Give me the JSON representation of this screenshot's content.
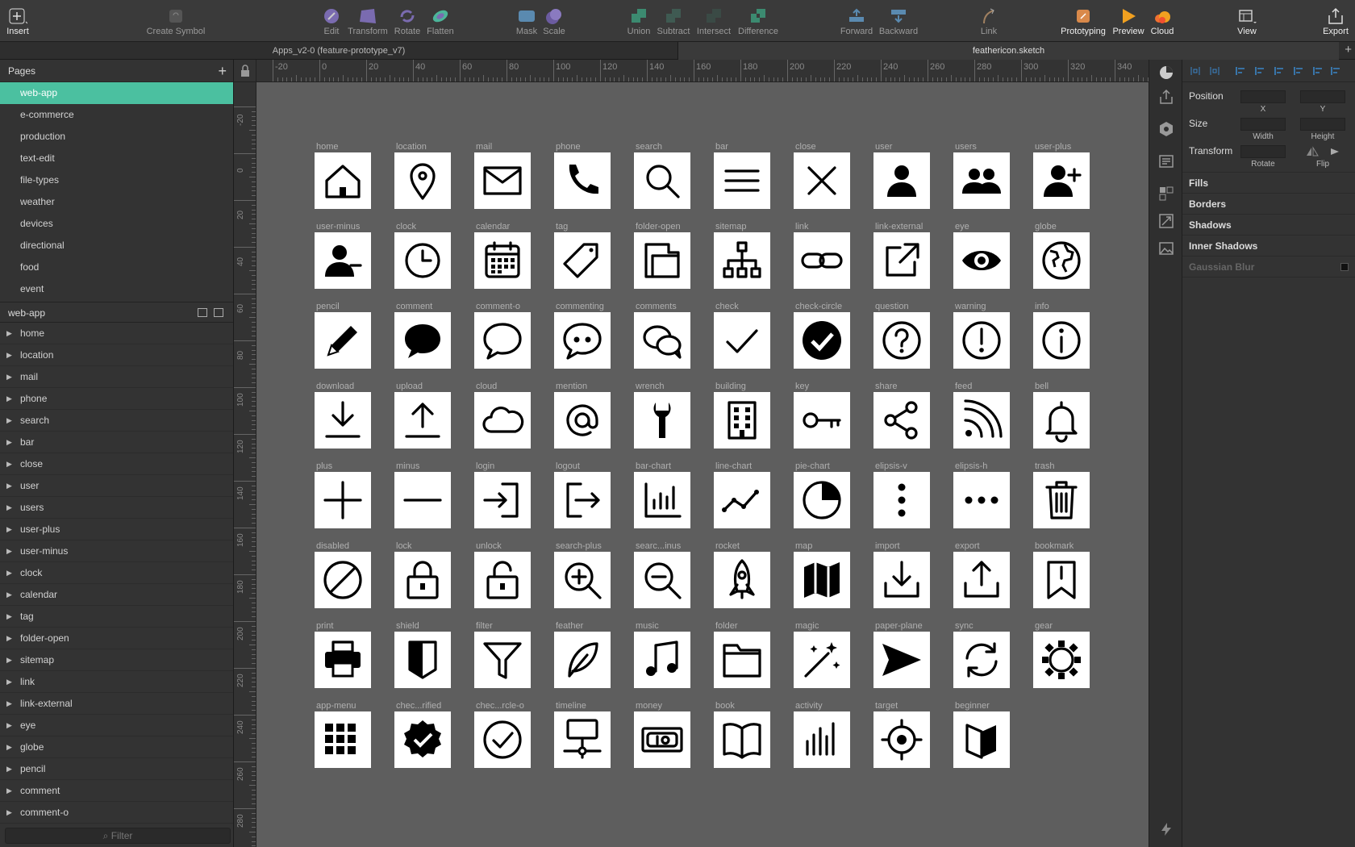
{
  "toolbar": {
    "items": [
      {
        "label": "Insert",
        "icon": "plus-icon",
        "white": true
      },
      {
        "label": "Create Symbol",
        "icon": "symbol-icon"
      },
      {
        "label": "Edit",
        "icon": "edit-icon"
      },
      {
        "label": "Transform",
        "icon": "transform-icon"
      },
      {
        "label": "Rotate",
        "icon": "rotate-icon"
      },
      {
        "label": "Flatten",
        "icon": "flatten-icon"
      },
      {
        "label": "Mask",
        "icon": "mask-icon"
      },
      {
        "label": "Scale",
        "icon": "scale-icon"
      },
      {
        "label": "Union",
        "icon": "union-icon"
      },
      {
        "label": "Subtract",
        "icon": "subtract-icon"
      },
      {
        "label": "Intersect",
        "icon": "intersect-icon"
      },
      {
        "label": "Difference",
        "icon": "difference-icon"
      },
      {
        "label": "Forward",
        "icon": "forward-icon"
      },
      {
        "label": "Backward",
        "icon": "backward-icon"
      },
      {
        "label": "Link",
        "icon": "link-icon"
      },
      {
        "label": "Prototyping",
        "icon": "prototyping-icon",
        "white": true
      },
      {
        "label": "Preview",
        "icon": "preview-icon",
        "white": true
      },
      {
        "label": "Cloud",
        "icon": "cloud-icon",
        "white": true
      },
      {
        "label": "View",
        "icon": "view-icon",
        "white": true
      },
      {
        "label": "Export",
        "icon": "export-icon",
        "white": true
      }
    ]
  },
  "tabs": {
    "left": "Apps_v2-0 (feature-prototype_v7)",
    "right": "feathericon.sketch",
    "plus": "+"
  },
  "sidebar": {
    "pages_title": "Pages",
    "pages": [
      "web-app",
      "e-commerce",
      "production",
      "text-edit",
      "file-types",
      "weather",
      "devices",
      "directional",
      "food",
      "event"
    ],
    "active_page": "web-app",
    "layers_title": "web-app",
    "layers": [
      "home",
      "location",
      "mail",
      "phone",
      "search",
      "bar",
      "close",
      "user",
      "users",
      "user-plus",
      "user-minus",
      "clock",
      "calendar",
      "tag",
      "folder-open",
      "sitemap",
      "link",
      "link-external",
      "eye",
      "globe",
      "pencil",
      "comment",
      "comment-o"
    ],
    "filter_placeholder": "Filter"
  },
  "ruler": {
    "h_labels": [
      "-20",
      "0",
      "20",
      "40",
      "60",
      "80",
      "100",
      "120",
      "140",
      "160",
      "180",
      "200",
      "220",
      "240",
      "260",
      "280",
      "300",
      "320",
      "340"
    ],
    "v_labels": [
      "-20",
      "0",
      "20",
      "40",
      "60",
      "80",
      "100",
      "120",
      "140",
      "160",
      "180",
      "200",
      "220",
      "240",
      "260",
      "280"
    ]
  },
  "artboards": [
    [
      "home",
      "location",
      "mail",
      "phone",
      "search",
      "bar",
      "close",
      "user",
      "users",
      "user-plus"
    ],
    [
      "user-minus",
      "clock",
      "calendar",
      "tag",
      "folder-open",
      "sitemap",
      "link",
      "link-external",
      "eye",
      "globe"
    ],
    [
      "pencil",
      "comment",
      "comment-o",
      "commenting",
      "comments",
      "check",
      "check-circle",
      "question",
      "warning",
      "info"
    ],
    [
      "download",
      "upload",
      "cloud",
      "mention",
      "wrench",
      "building",
      "key",
      "share",
      "feed",
      "bell"
    ],
    [
      "plus",
      "minus",
      "login",
      "logout",
      "bar-chart",
      "line-chart",
      "pie-chart",
      "elipsis-v",
      "elipsis-h",
      "trash"
    ],
    [
      "disabled",
      "lock",
      "unlock",
      "search-plus",
      "searc...inus",
      "rocket",
      "map",
      "import",
      "export",
      "bookmark"
    ],
    [
      "print",
      "shield",
      "filter",
      "feather",
      "music",
      "folder",
      "magic",
      "paper-plane",
      "sync",
      "gear"
    ],
    [
      "app-menu",
      "chec...rified",
      "chec...rcle-o",
      "timeline",
      "money",
      "book",
      "activity",
      "target",
      "beginner"
    ]
  ],
  "inspector": {
    "position": "Position",
    "x": "X",
    "y": "Y",
    "size": "Size",
    "width": "Width",
    "height": "Height",
    "transform": "Transform",
    "rotate": "Rotate",
    "flip": "Flip",
    "sections": [
      "Fills",
      "Borders",
      "Shadows",
      "Inner Shadows"
    ],
    "gaussian": "Gaussian Blur"
  },
  "colors": {
    "accent": "#4bc0a0",
    "canvas": "#5e5e5e"
  }
}
